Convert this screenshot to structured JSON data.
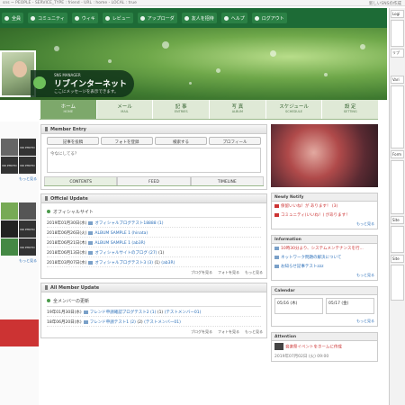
{
  "debug": {
    "left": "sns ~ PEOPLE - SERVICE_TYPE : friend - URL : home - LOCAL : true",
    "right": "新しいSNSの作成"
  },
  "nav": [
    {
      "label": "全員",
      "color": "#cfe3d4"
    },
    {
      "label": "コミュニティ"
    },
    {
      "label": "ウィキ"
    },
    {
      "label": "レビュー"
    },
    {
      "label": "アップローダ"
    },
    {
      "label": "友人を招待"
    },
    {
      "label": "ヘルプ"
    },
    {
      "label": "ログアウト"
    }
  ],
  "banner": {
    "sm": "SNS MANAGER",
    "title": "リブインターネット",
    "msg": "ここにメッセージを表示できます。"
  },
  "tabs": [
    {
      "j": "ホーム",
      "e": "HOME"
    },
    {
      "j": "メール",
      "e": "MAIL"
    },
    {
      "j": "記 事",
      "e": "ENTRIES"
    },
    {
      "j": "写 真",
      "e": "ALBUM"
    },
    {
      "j": "スケジュール",
      "e": "SCHEDULE"
    },
    {
      "j": "設 定",
      "e": "SETTING"
    }
  ],
  "left": {
    "no_photo": "NO PHOTO",
    "more": "もっと見る"
  },
  "entry": {
    "title": "Member Entry",
    "buttons": [
      "記事を投稿",
      "フォトを登録",
      "検索する",
      "プロフィール"
    ],
    "placeholder": "今なにしてる？",
    "tabs": [
      "CONTENTS",
      "FEED",
      "TIMELINE"
    ]
  },
  "official": {
    "title": "Official Update",
    "section": "オフィシャルサイト",
    "rows": [
      {
        "date": "2019年01月30日(水)",
        "text": "オフィシャルブログテスト18888 (1)"
      },
      {
        "date": "2018年06月26日(火)",
        "text": "ALBUM SAMPLE 1",
        "user": "(hinata)"
      },
      {
        "date": "2018年06月21日(木)",
        "text": "ALBUM SAMPLE 1",
        "user": "(ab3R)"
      },
      {
        "date": "2018年06月13日(水)",
        "text": "オフィシャルサイトのブログ (27)",
        "count": "(1)"
      },
      {
        "date": "2018年03月07日(水)",
        "text": "オフィシャルブログテスト3 (3)",
        "count": "(1)",
        "user": "(ab3R)"
      }
    ],
    "foot": [
      "ブログを見る",
      "フォトを見る",
      "もっと見る"
    ]
  },
  "all": {
    "title": "All Member Update",
    "section": "全メンバーの更新",
    "rows": [
      {
        "date": "19年01月30日(水)",
        "text": "フレンド申請確認ブログテスト2 (1)",
        "count": "(1)",
        "user": "(テストメンバー01)"
      },
      {
        "date": "18年06月20日(水)",
        "text": "フレンド申請テスト1 (2)",
        "count": "(2)",
        "user": "(テストメンバー01)"
      }
    ],
    "foot": [
      "ブログを見る",
      "フォトを見る",
      "もっと見る"
    ]
  },
  "notify": {
    "title": "Newly Notify",
    "rows": [
      "保留いいね！が あります！ (3)",
      "コミュニティ(いいね！) があります！"
    ],
    "more": "もっと見る"
  },
  "info": {
    "title": "Information",
    "rows": [
      "10時30分より、システムメンテナンスを行...",
      "ネットワーク問題の解決について",
      "お知らせ記事テストzzz"
    ],
    "more": "もっと見る"
  },
  "calendar": {
    "title": "Calendar",
    "days": [
      "05/16 (木)",
      "05/17 (金)"
    ],
    "more": "もっと見る"
  },
  "attention": {
    "title": "Attention",
    "row": "音楽祭イベントをホームに作成",
    "date": "2019年07月02日 (火) 09:00"
  },
  "rcol": [
    "Logi",
    "リブ",
    "Vari",
    "Form",
    "Site",
    "Site"
  ]
}
